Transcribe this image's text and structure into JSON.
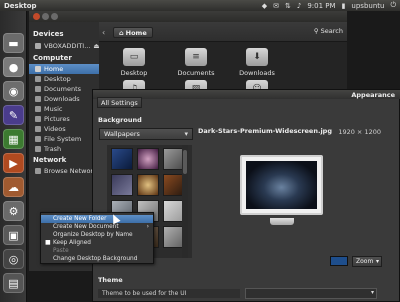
{
  "top_panel": {
    "title": "Desktop",
    "time": "9:01 PM",
    "user": "upsbuntu",
    "icons": [
      "dropbox-icon",
      "mail-icon",
      "network-icon",
      "volume-icon",
      "power-icon"
    ]
  },
  "launcher": {
    "items": [
      {
        "name": "home-folder-launcher",
        "color": "#6b6b6b",
        "glyph": "🏠"
      },
      {
        "name": "firefox-launcher",
        "color": "#888888",
        "glyph": "●"
      },
      {
        "name": "software-center-launcher",
        "color": "#6d6d6d",
        "glyph": "◉"
      },
      {
        "name": "writer-launcher",
        "color": "#4a3c8c",
        "glyph": "✎"
      },
      {
        "name": "calc-launcher",
        "color": "#3c7a30",
        "glyph": "▦"
      },
      {
        "name": "impress-launcher",
        "color": "#b04a20",
        "glyph": "▶"
      },
      {
        "name": "ubuntu-one-launcher",
        "color": "#a05a30",
        "glyph": "☁"
      },
      {
        "name": "system-settings-launcher",
        "color": "#6a6a6a",
        "glyph": "⚙"
      },
      {
        "name": "workspace-switcher-launcher",
        "color": "#5a5a5a",
        "glyph": "▣"
      },
      {
        "name": "terminal-launcher",
        "color": "#4a4a4a",
        "glyph": "▮"
      },
      {
        "name": "disc-launcher",
        "color": "#5a5a5a",
        "glyph": "◎"
      },
      {
        "name": "trash-launcher",
        "color": "#5a5a5a",
        "glyph": "🗑"
      }
    ]
  },
  "files": {
    "sidebar": {
      "devices_header": "Devices",
      "devices": [
        {
          "label": "VBOXADDITI..."
        }
      ],
      "computer_header": "Computer",
      "computer": [
        {
          "label": "Home",
          "selected": true
        },
        {
          "label": "Desktop"
        },
        {
          "label": "Documents"
        },
        {
          "label": "Downloads"
        },
        {
          "label": "Music"
        },
        {
          "label": "Pictures"
        },
        {
          "label": "Videos"
        },
        {
          "label": "File System"
        },
        {
          "label": "Trash"
        }
      ],
      "network_header": "Network",
      "network": [
        {
          "label": "Browse Network"
        }
      ]
    },
    "breadcrumb": "Home",
    "search_label": "Search",
    "tiles": [
      {
        "label": "Desktop",
        "icon": "desktop-folder-icon"
      },
      {
        "label": "Documents",
        "icon": "documents-folder-icon"
      },
      {
        "label": "Downloads",
        "icon": "downloads-folder-icon"
      },
      {
        "label": "",
        "icon": "music-folder-icon"
      },
      {
        "label": "",
        "icon": "pictures-folder-icon"
      },
      {
        "label": "",
        "icon": "public-folder-icon"
      }
    ]
  },
  "appearance": {
    "title": "Appearance",
    "all_settings": "All Settings",
    "background_label": "Background",
    "wallpaper_select": "Wallpapers",
    "wallpaper_name": "Dark-Stars-Premium-Widescreen.jpg",
    "wallpaper_dims": "1920 × 1200",
    "zoom_select": "Zoom",
    "theme_label": "Theme",
    "theme_desc": "Theme to be used for the UI",
    "swatch_color": "#1e4e8c"
  },
  "context_menu": {
    "items": [
      {
        "label": "Create New Folder",
        "highlighted": true
      },
      {
        "label": "Create New Document",
        "submenu": true
      },
      {
        "label": "Organize Desktop by Name"
      },
      {
        "label": "Keep Aligned",
        "checked": true
      },
      {
        "label": "Paste",
        "disabled": true
      },
      {
        "label": "Change Desktop Background"
      }
    ]
  }
}
